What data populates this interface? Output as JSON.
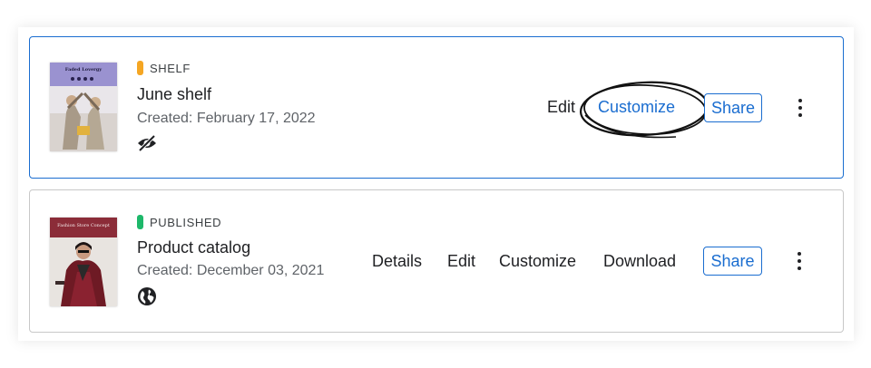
{
  "items": [
    {
      "status": "SHELF",
      "status_color": "#f5a623",
      "title": "June shelf",
      "created": "Created: February 17, 2022",
      "visibility_icon": "hidden-eye-icon",
      "thumbnail": {
        "heading": "Faded Lovergy",
        "accent": "#8f86c9"
      },
      "actions": {
        "edit": "Edit",
        "customize": "Customize",
        "share": "Share"
      }
    },
    {
      "status": "PUBLISHED",
      "status_color": "#1db86a",
      "title": "Product catalog",
      "created": "Created: December 03, 2021",
      "visibility_icon": "globe-icon",
      "thumbnail": {
        "heading": "Fashion Store Concept",
        "accent": "#8b2c38"
      },
      "actions": {
        "details": "Details",
        "edit": "Edit",
        "customize": "Customize",
        "download": "Download",
        "share": "Share"
      }
    }
  ],
  "colors": {
    "accent": "#1a6dd0",
    "selected_border": "#1a6dd0"
  }
}
